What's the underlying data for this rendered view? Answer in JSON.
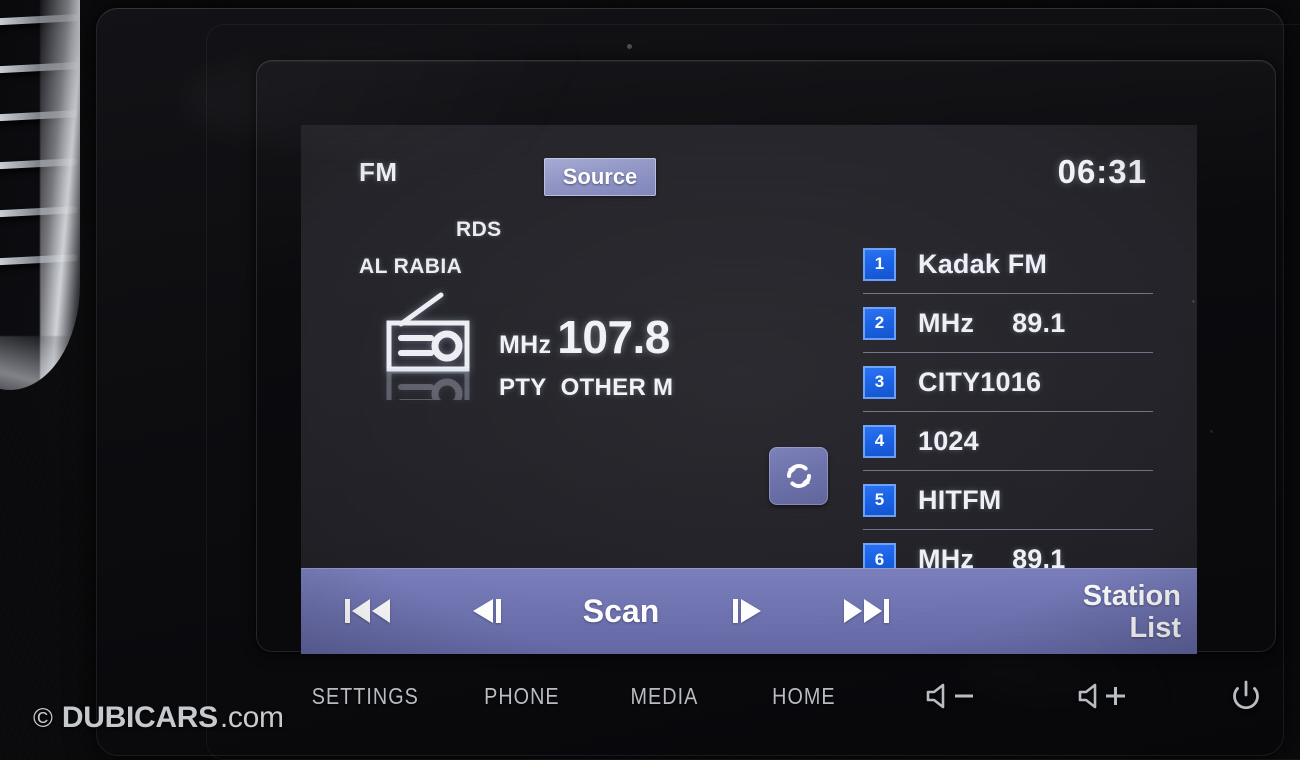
{
  "head_unit": {
    "screen": {
      "band": "FM",
      "source_button": "Source",
      "clock": "06:31",
      "now_playing": {
        "rds": "RDS",
        "station_name": "AL RABIA",
        "radio_icon": "radio-icon",
        "frequency_unit": "MHz",
        "frequency_value": "107.8",
        "pty_label": "PTY",
        "pty_value": "OTHER M"
      },
      "refresh_button": {
        "icon": "refresh-icon"
      },
      "station_list": [
        {
          "preset": "1",
          "unit": "",
          "label": "Kadak FM"
        },
        {
          "preset": "2",
          "unit": "MHz",
          "label": "89.1"
        },
        {
          "preset": "3",
          "unit": "",
          "label": "CITY1016"
        },
        {
          "preset": "4",
          "unit": "",
          "label": "1024"
        },
        {
          "preset": "5",
          "unit": "",
          "label": "HITFM"
        },
        {
          "preset": "6",
          "unit": "MHz",
          "label": "89.1"
        }
      ],
      "scroll": {
        "up_icon": "chevron-up-icon",
        "down_icon": "chevron-down-icon",
        "thumb_percent": "57"
      },
      "control_bar": {
        "prev_track_icon": "previous-track-icon",
        "tune_down_icon": "tune-down-icon",
        "scan_label": "Scan",
        "tune_up_icon": "tune-up-icon",
        "next_track_icon": "next-track-icon",
        "station_list_line1": "Station",
        "station_list_line2": "List"
      }
    },
    "hardware_buttons": [
      {
        "id": "settings",
        "label": "SETTINGS"
      },
      {
        "id": "phone",
        "label": "PHONE"
      },
      {
        "id": "media",
        "label": "MEDIA"
      },
      {
        "id": "home",
        "label": "HOME"
      },
      {
        "id": "vol-down",
        "label": "",
        "icon": "volume-down-icon"
      },
      {
        "id": "vol-up",
        "label": "",
        "icon": "volume-up-icon"
      },
      {
        "id": "power",
        "label": "",
        "icon": "power-icon"
      }
    ]
  },
  "watermark": {
    "copyright": "©",
    "brand": "DUBICARS",
    "tld": ".com"
  },
  "colors": {
    "accent_purple": "#6f74b2",
    "source_button": "#9398c8",
    "preset_badge_blue": "#1560e8",
    "chevron_active_blue": "#1f8cff",
    "screen_background": "#222228",
    "text_primary": "#f1f2f7",
    "hardware_label": "#b9bcc2"
  }
}
